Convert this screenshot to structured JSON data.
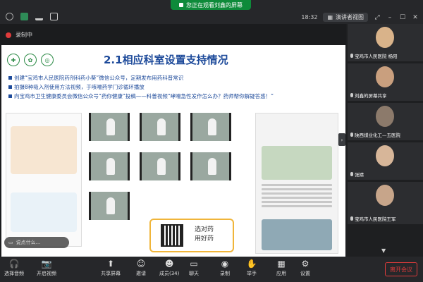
{
  "share_banner": {
    "text": "您正在观看刘鑫的屏幕"
  },
  "topbar": {
    "time": "18:32",
    "view_label": "演讲者视图"
  },
  "main": {
    "recording_label": "录制中",
    "slide": {
      "title": "2.1相应科室设置支持情况",
      "bullets": [
        "创建“宝鸡市人民医院药剂科药小葵”微信公众号，定期发布用药科普常识",
        "拍摄8种吸入剂使用方法视频，于咳喘药学门诊循环播放",
        "向宝鸡市卫生健康委员会微信公众号“药你健康”投稿——科普视频“哮喘急性发作怎么办？药师帮你解疑答惑！”"
      ],
      "qr_text_1": "选对药",
      "qr_text_2": "用好药",
      "comment_placeholder": "说点什么..."
    }
  },
  "participants": [
    {
      "name": "宝鸡市人民医院 杨阳",
      "face_color": "#d9b38a"
    },
    {
      "name": "刘鑫的屏幕共享",
      "face_color": "#c99f7e"
    },
    {
      "name": "陕西煤业化工—五医院",
      "face_color": "#8c7a6b"
    },
    {
      "name": "张婧",
      "face_color": "#d7b699"
    },
    {
      "name": "宝鸡市人民医院王军",
      "face_color": "#c7a58a"
    }
  ],
  "bottombar": {
    "audio": "选择音频",
    "video": "开启视频",
    "share": "共享屏幕",
    "invite": "邀请",
    "members": "成员(34)",
    "chat": "聊天",
    "record": "录制",
    "raise_hand": "举手",
    "apps": "应用",
    "settings": "设置",
    "leave": "离开会议"
  },
  "colors": {
    "accent_red": "#e03b3b",
    "share_green": "#0e8a3a",
    "slide_blue": "#1d4a9a"
  }
}
